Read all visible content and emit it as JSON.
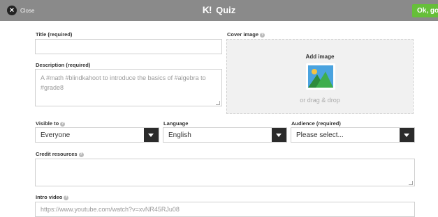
{
  "header": {
    "close_label": "Close",
    "logo_text": "K!",
    "title": "Quiz",
    "ok_label": "Ok, go"
  },
  "form": {
    "title_label": "Title (required)",
    "title_value": "",
    "description_label": "Description (required)",
    "description_placeholder": "A #math #blindkahoot to introduce the basics of #algebra to #grade8",
    "cover_label": "Cover image",
    "cover_add_label": "Add image",
    "cover_drag_label": "or drag & drop",
    "visible_label": "Visible to",
    "visible_value": "Everyone",
    "language_label": "Language",
    "language_value": "English",
    "audience_label": "Audience (required)",
    "audience_value": "Please select...",
    "credit_label": "Credit resources",
    "credit_value": "",
    "intro_label": "Intro video",
    "intro_placeholder": "https://www.youtube.com/watch?v=xvNR45RJu08"
  },
  "icons": {
    "close": "close-icon",
    "help": "help-icon",
    "image": "image-placeholder-icon",
    "dropdown": "chevron-down-icon",
    "resize": "resize-handle-icon"
  },
  "colors": {
    "topbar": "#8a8a8a",
    "ok_button": "#66bf39",
    "cover_bg": "#f1f1f1",
    "select_arrow": "#2b2b2b"
  }
}
